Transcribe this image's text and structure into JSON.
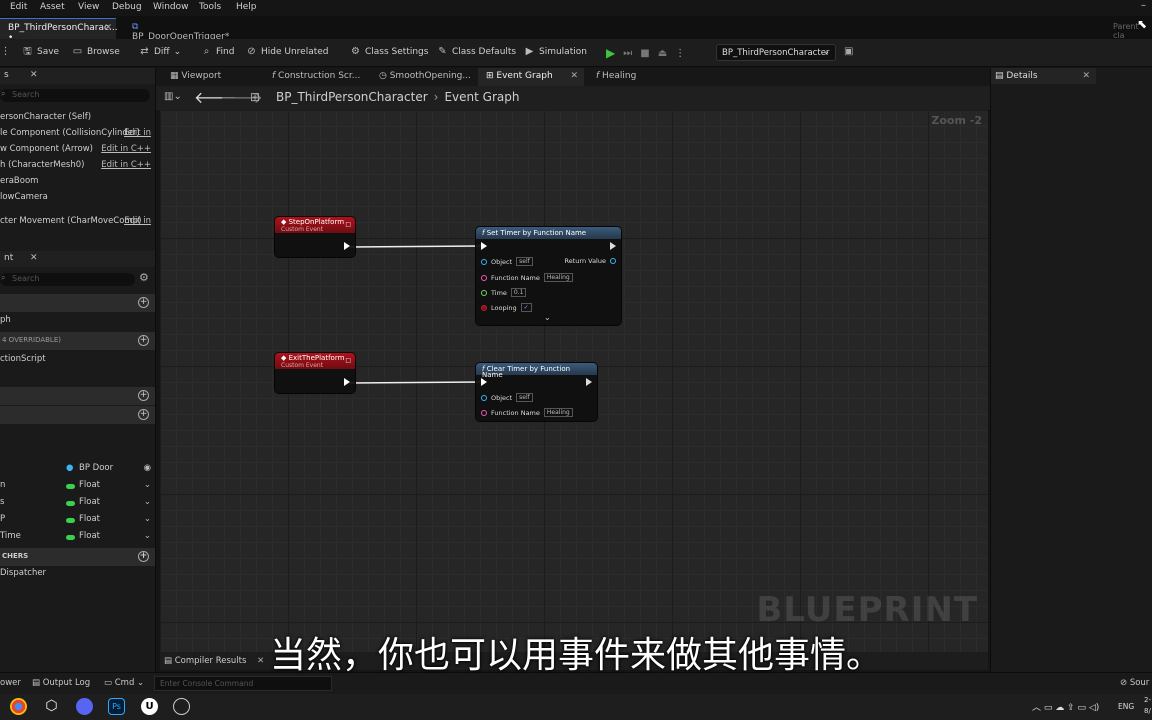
{
  "menu": [
    "Edit",
    "Asset",
    "View",
    "Debug",
    "Window",
    "Tools",
    "Help"
  ],
  "tabs": [
    {
      "label": "BP_ThirdPersonCharac... •",
      "active": true
    },
    {
      "label": "BP_DoorOpenTrigger*",
      "active": false
    }
  ],
  "parent_class_label": "Parent cla",
  "toolbar": {
    "save": "Save",
    "browse": "Browse",
    "diff": "Diff",
    "find": "Find",
    "hide_unrelated": "Hide Unrelated",
    "class_settings": "Class Settings",
    "class_defaults": "Class Defaults",
    "simulation": "Simulation",
    "debug_object": "BP_ThirdPersonCharacter"
  },
  "components": {
    "header": "s",
    "search_placeholder": "Search",
    "items": [
      {
        "label": "ersonCharacter (Self)",
        "edit": ""
      },
      {
        "label": "le Component (CollisionCylinder)",
        "edit": "Edit in"
      },
      {
        "label": "w Component (Arrow)",
        "edit": "Edit in C++"
      },
      {
        "label": "h (CharacterMesh0)",
        "edit": "Edit in C++"
      },
      {
        "label": "eraBoom",
        "edit": ""
      },
      {
        "label": "lowCamera",
        "edit": ""
      },
      {
        "label": "cter Movement (CharMoveComp)",
        "edit": "Edit in"
      }
    ]
  },
  "my_blueprint": {
    "header": "nt",
    "search_placeholder": "Search",
    "graph_label": "ph",
    "overridable": "4 OVERRIDABLE)",
    "construction_script": "ctionScript",
    "variables": [
      {
        "label": "",
        "type": "BP Door",
        "kind": "object"
      },
      {
        "label": "n",
        "type": "Float",
        "kind": "float"
      },
      {
        "label": "s",
        "type": "Float",
        "kind": "float"
      },
      {
        "label": "P",
        "type": "Float",
        "kind": "float"
      },
      {
        "label": "Time",
        "type": "Float",
        "kind": "float"
      }
    ],
    "dispatchers_header": "CHERS",
    "dispatcher": "Dispatcher"
  },
  "graph_tabs": [
    {
      "label": "Viewport",
      "active": false
    },
    {
      "label": "Construction Scr...",
      "active": false
    },
    {
      "label": "SmoothOpening...",
      "active": false
    },
    {
      "label": "Event Graph",
      "active": true
    },
    {
      "label": "Healing",
      "active": false
    }
  ],
  "breadcrumb": {
    "root": "BP_ThirdPersonCharacter",
    "current": "Event Graph"
  },
  "zoom": "Zoom -2",
  "nodes": {
    "step_event": {
      "title": "StepOnPlatform",
      "subtitle": "Custom Event"
    },
    "exit_event": {
      "title": "ExitThePlatform",
      "subtitle": "Custom Event"
    },
    "set_timer": {
      "title": "Set Timer by Function Name",
      "object_label": "Object",
      "object_value": "self",
      "return_label": "Return Value",
      "func_label": "Function Name",
      "func_value": "Healing",
      "time_label": "Time",
      "time_value": "0.1",
      "looping_label": "Looping",
      "looping_value": "✓"
    },
    "clear_timer": {
      "title": "Clear Timer by Function Name",
      "object_label": "Object",
      "object_value": "self",
      "func_label": "Function Name",
      "func_value": "Healing"
    }
  },
  "watermark": "BLUEPRINT",
  "details_title": "Details",
  "compiler_results": "Compiler Results",
  "bottom": {
    "drawer": "ower",
    "output_log": "Output Log",
    "cmd": "Cmd",
    "console_placeholder": "Enter Console Command",
    "source": "Sour"
  },
  "tray": {
    "lang": "ENG",
    "time": "2-",
    "date": "8/"
  },
  "subtitle": "当然，你也可以用事件来做其他事情。"
}
